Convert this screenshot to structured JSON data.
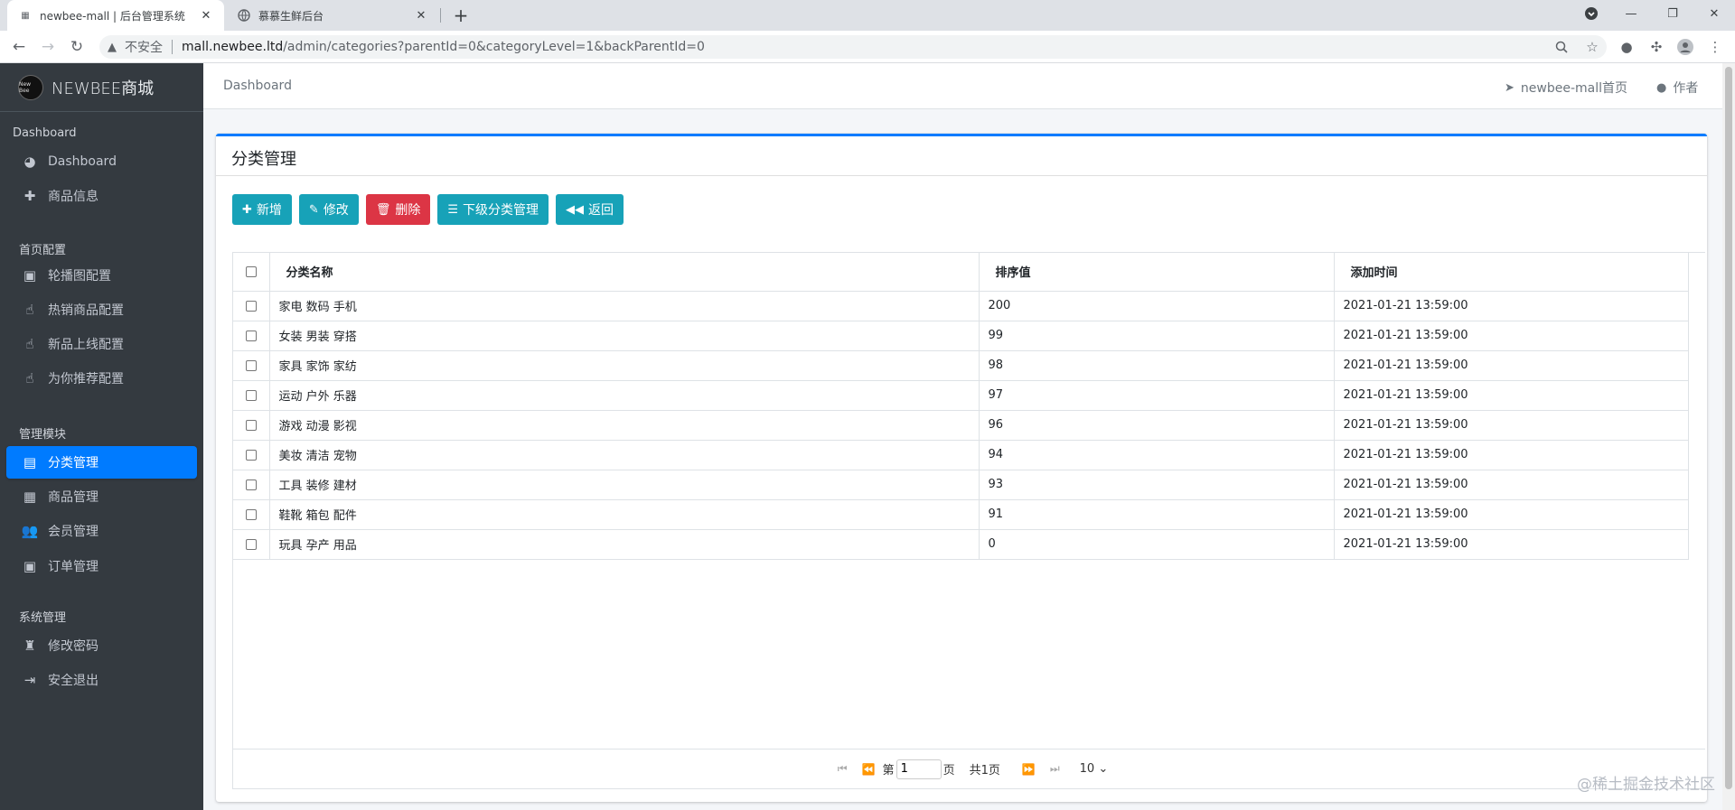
{
  "browser": {
    "tabs": [
      {
        "title": "newbee-mall | 后台管理系统",
        "icon": "newbee-favicon"
      },
      {
        "title": "慕慕生鲜后台",
        "icon": "globe-icon"
      }
    ],
    "insecure_label": "不安全",
    "url_host": "mall.newbee.ltd",
    "url_path": "/admin/categories?parentId=0&categoryLevel=1&backParentId=0"
  },
  "sidebar": {
    "brand": "NEWBEE商城",
    "logo_text": "New Bee",
    "sections": [
      {
        "header": "Dashboard",
        "items": [
          {
            "label": "Dashboard",
            "icon": "tachometer-icon"
          },
          {
            "label": "商品信息",
            "icon": "plus-icon"
          }
        ]
      },
      {
        "header": "首页配置",
        "items": [
          {
            "label": "轮播图配置",
            "icon": "image-icon"
          },
          {
            "label": "热销商品配置",
            "icon": "hand-pointer-icon"
          },
          {
            "label": "新品上线配置",
            "icon": "hand-pointer-icon"
          },
          {
            "label": "为你推荐配置",
            "icon": "hand-pointer-icon"
          }
        ]
      },
      {
        "header": "管理模块",
        "items": [
          {
            "label": "分类管理",
            "icon": "list-alt-icon",
            "active": true
          },
          {
            "label": "商品管理",
            "icon": "table-icon"
          },
          {
            "label": "会员管理",
            "icon": "users-icon"
          },
          {
            "label": "订单管理",
            "icon": "money-icon"
          }
        ]
      },
      {
        "header": "系统管理",
        "items": [
          {
            "label": "修改密码",
            "icon": "user-secret-icon"
          },
          {
            "label": "安全退出",
            "icon": "sign-out-icon"
          }
        ]
      }
    ]
  },
  "topnav": {
    "breadcrumb": "Dashboard",
    "home_link": "newbee-mall首页",
    "author_link": "作者"
  },
  "card": {
    "title": "分类管理",
    "buttons": {
      "add": "新增",
      "edit": "修改",
      "delete": "删除",
      "sub": "下级分类管理",
      "back": "返回"
    }
  },
  "table": {
    "headers": [
      "分类名称",
      "排序值",
      "添加时间"
    ],
    "rows": [
      [
        "家电 数码 手机",
        "200",
        "2021-01-21 13:59:00"
      ],
      [
        "女装 男装 穿搭",
        "99",
        "2021-01-21 13:59:00"
      ],
      [
        "家具 家饰 家纺",
        "98",
        "2021-01-21 13:59:00"
      ],
      [
        "运动 户外 乐器",
        "97",
        "2021-01-21 13:59:00"
      ],
      [
        "游戏 动漫 影视",
        "96",
        "2021-01-21 13:59:00"
      ],
      [
        "美妆 清洁 宠物",
        "94",
        "2021-01-21 13:59:00"
      ],
      [
        "工具 装修 建材",
        "93",
        "2021-01-21 13:59:00"
      ],
      [
        "鞋靴 箱包 配件",
        "91",
        "2021-01-21 13:59:00"
      ],
      [
        "玩具 孕产 用品",
        "0",
        "2021-01-21 13:59:00"
      ]
    ]
  },
  "pager": {
    "page_prefix": "第",
    "page_value": "1",
    "page_suffix": "页",
    "total": "共1页",
    "page_size": "10"
  },
  "watermark": "@稀土掘金技术社区",
  "colors": {
    "primary": "#007bff",
    "info": "#17a2b8",
    "danger": "#dc3545",
    "sidebar_bg": "#343a40"
  }
}
